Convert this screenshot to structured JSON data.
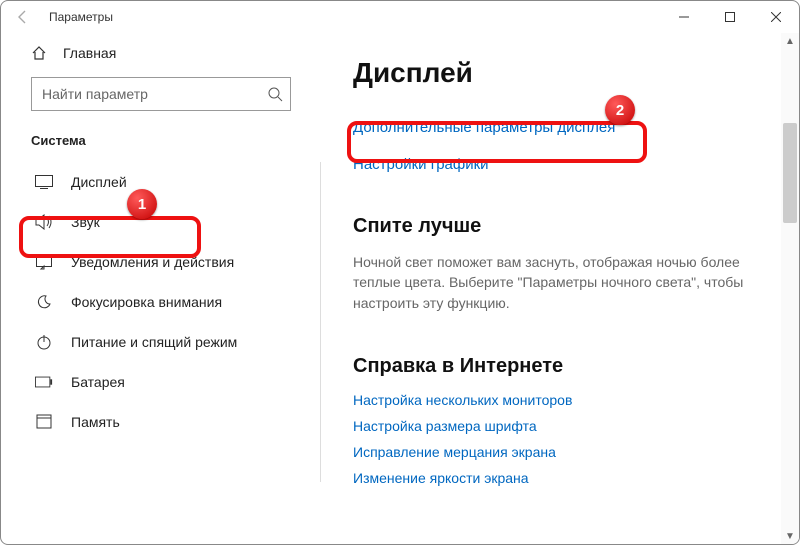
{
  "window": {
    "title": "Параметры"
  },
  "sidebar": {
    "home": "Главная",
    "search_placeholder": "Найти параметр",
    "section": "Система",
    "items": [
      {
        "label": "Дисплей"
      },
      {
        "label": "Звук"
      },
      {
        "label": "Уведомления и действия"
      },
      {
        "label": "Фокусировка внимания"
      },
      {
        "label": "Питание и спящий режим"
      },
      {
        "label": "Батарея"
      },
      {
        "label": "Память"
      }
    ]
  },
  "main": {
    "heading": "Дисплей",
    "link_advanced": "Дополнительные параметры дисплея",
    "link_graphics": "Настройки графики",
    "sleep_heading": "Спите лучше",
    "sleep_desc": "Ночной свет поможет вам заснуть, отображая ночью более теплые цвета. Выберите \"Параметры ночного света\", чтобы настроить эту функцию.",
    "help_heading": "Справка в Интернете",
    "help_links": [
      "Настройка нескольких мониторов",
      "Настройка размера шрифта",
      "Исправление мерцания экрана",
      "Изменение яркости экрана"
    ]
  },
  "annotations": {
    "badge1": "1",
    "badge2": "2"
  }
}
